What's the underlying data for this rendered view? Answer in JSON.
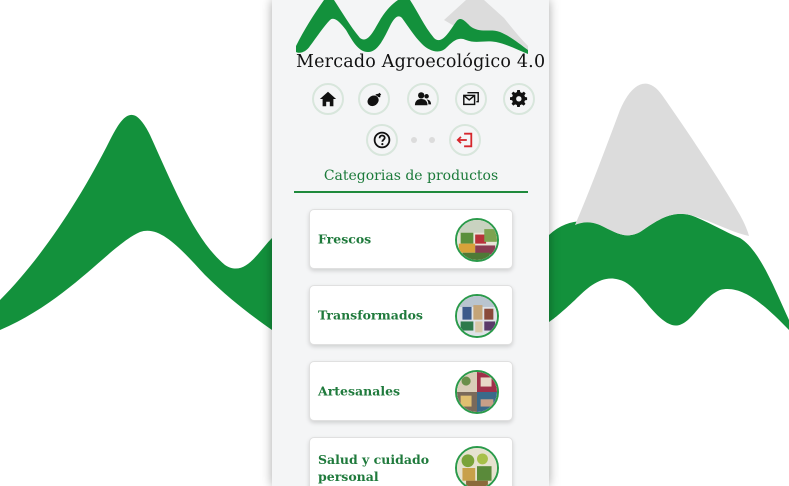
{
  "app": {
    "logo_text": "Mercado Agroecológico 4.0",
    "colors": {
      "green": "#13913c",
      "dark_green": "#1f7a3c",
      "snow": "#dcdcdc",
      "exit_red": "#d6262c"
    }
  },
  "toolbar": {
    "home_icon": "home-icon",
    "produce_icon": "eggplant-icon",
    "users_icon": "users-icon",
    "messages_icon": "envelope-icon",
    "settings_icon": "gear-icon",
    "help_icon": "question-icon",
    "logout_icon": "logout-icon"
  },
  "categories": {
    "title": "Categorias de productos",
    "items": [
      {
        "label": "Frescos",
        "thumb_icon": "fresh-produce-photo"
      },
      {
        "label": "Transformados",
        "thumb_icon": "processed-goods-photo"
      },
      {
        "label": "Artesanales",
        "thumb_icon": "crafts-photo"
      },
      {
        "label": "Salud y cuidado personal",
        "thumb_icon": "health-care-photo"
      }
    ]
  }
}
